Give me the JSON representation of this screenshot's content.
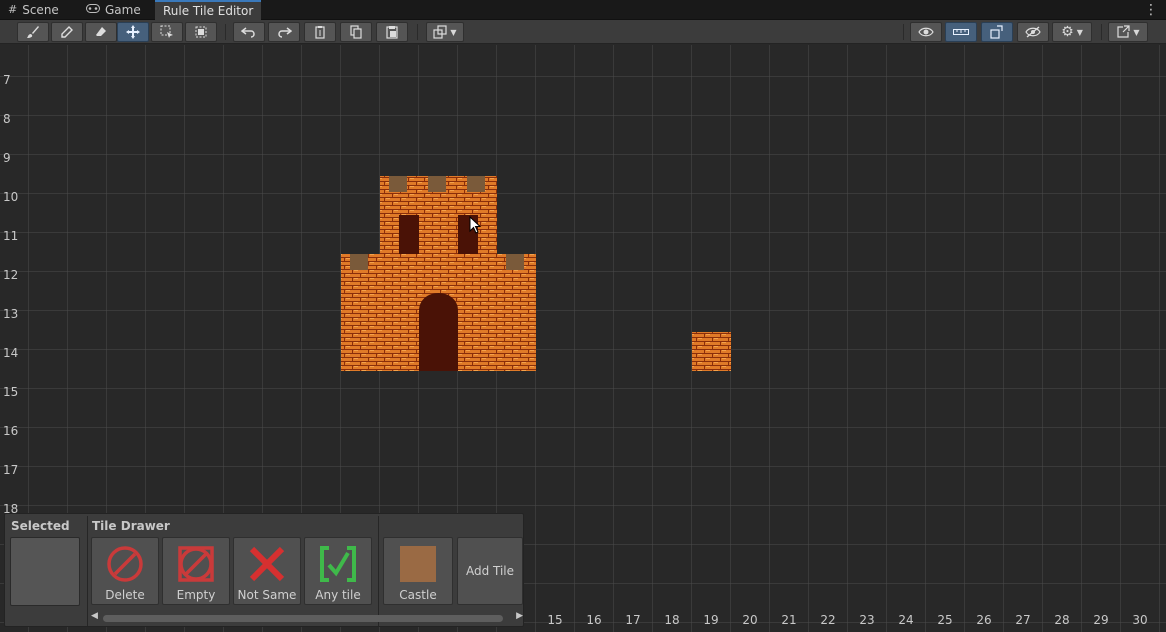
{
  "tabs": [
    {
      "label": "Scene",
      "icon": "grid-icon"
    },
    {
      "label": "Game",
      "icon": "gamepad-icon"
    },
    {
      "label": "Rule Tile Editor",
      "icon": ""
    }
  ],
  "rows": [
    "7",
    "8",
    "9",
    "10",
    "11",
    "12",
    "13",
    "14",
    "15",
    "16",
    "17",
    "18"
  ],
  "cols": [
    "15",
    "16",
    "17",
    "18",
    "19",
    "20",
    "21",
    "22",
    "23",
    "24",
    "25",
    "26",
    "27",
    "28",
    "29",
    "30"
  ],
  "palette": {
    "selected_header": "Selected",
    "drawer_header": "Tile Drawer",
    "items": [
      {
        "label": "Delete",
        "icon": "delete-icon"
      },
      {
        "label": "Empty",
        "icon": "empty-icon"
      },
      {
        "label": "Not Same",
        "icon": "not-same-icon"
      },
      {
        "label": "Any tile",
        "icon": "any-tile-icon"
      },
      {
        "label": "Castle",
        "icon": "castle-swatch-icon"
      }
    ],
    "add_tile": "Add Tile"
  },
  "colors": {
    "accent": "#3a79bb",
    "brick": "#e07a28",
    "brick_dark": "#8a2e0a",
    "door": "#4a1206",
    "battlement": "#7a5a3a",
    "red_icon": "#c93a3a",
    "green_icon": "#3fb94a"
  }
}
